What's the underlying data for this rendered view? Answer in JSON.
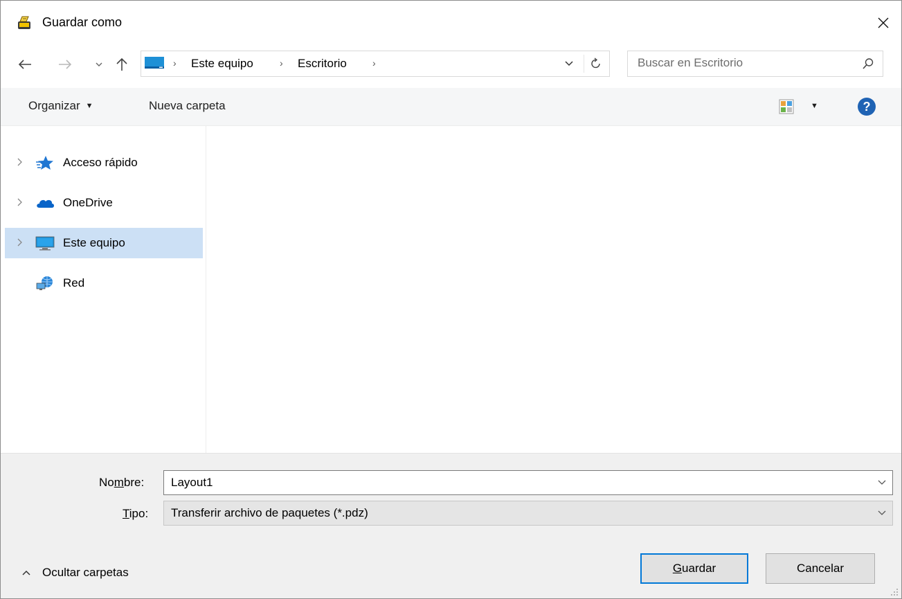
{
  "window": {
    "title": "Guardar como",
    "close_symbol": "✕"
  },
  "nav": {
    "back_icon": "back-arrow-icon",
    "forward_icon": "forward-arrow-icon",
    "recent_icon": "chevron-down-icon",
    "up_icon": "up-arrow-icon"
  },
  "address": {
    "crumbs": [
      "Este equipo",
      "Escritorio"
    ],
    "separator": "›"
  },
  "search": {
    "placeholder": "Buscar en Escritorio"
  },
  "toolbar": {
    "organize_label": "Organizar",
    "new_folder_label": "Nueva carpeta"
  },
  "tree": {
    "items": [
      {
        "label": "Acceso rápido",
        "icon": "star-icon",
        "expandable": true,
        "selected": false
      },
      {
        "label": "OneDrive",
        "icon": "cloud-icon",
        "expandable": true,
        "selected": false
      },
      {
        "label": "Este equipo",
        "icon": "computer-icon",
        "expandable": true,
        "selected": true
      },
      {
        "label": "Red",
        "icon": "network-icon",
        "expandable": false,
        "selected": false
      }
    ]
  },
  "form": {
    "name_label_pre": "No",
    "name_label_u": "m",
    "name_label_post": "bre:",
    "name_value": "Layout1",
    "type_label_u": "T",
    "type_label_post": "ipo:",
    "type_value": "Transferir archivo de paquetes (*.pdz)"
  },
  "footer": {
    "hide_folders_label": "Ocultar carpetas",
    "save_label_u": "G",
    "save_label_post": "uardar",
    "cancel_label": "Cancelar"
  },
  "colors": {
    "accent": "#0078d7",
    "selection": "#cce0f5",
    "help": "#1f63b4"
  }
}
